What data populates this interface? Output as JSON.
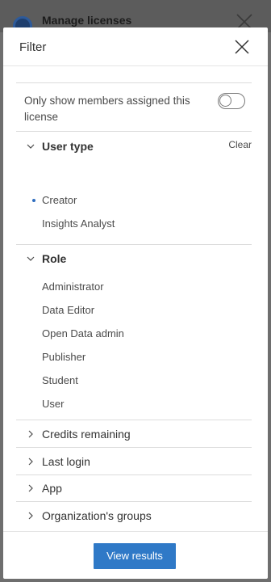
{
  "backdrop": {
    "title": "Manage licenses"
  },
  "panel": {
    "title": "Filter",
    "close_icon": "close-icon"
  },
  "toggle": {
    "label": "Only show members assigned this license",
    "checked": false
  },
  "user_type": {
    "label": "User type",
    "clear_label": "Clear",
    "expanded": true,
    "options": [
      {
        "label": "Creator",
        "selected": true
      },
      {
        "label": "Insights Analyst",
        "selected": false
      }
    ]
  },
  "role": {
    "label": "Role",
    "expanded": true,
    "options": [
      {
        "label": "Administrator"
      },
      {
        "label": "Data Editor"
      },
      {
        "label": "Open Data admin"
      },
      {
        "label": "Publisher"
      },
      {
        "label": "Student"
      },
      {
        "label": "User"
      }
    ]
  },
  "collapsed_sections": [
    {
      "label": "Credits remaining"
    },
    {
      "label": "Last login"
    },
    {
      "label": "App"
    },
    {
      "label": "Organization's groups"
    }
  ],
  "footer": {
    "view_results_label": "View results"
  },
  "colors": {
    "accent": "#2f79c7",
    "selected_dot": "#2f6dbf"
  }
}
